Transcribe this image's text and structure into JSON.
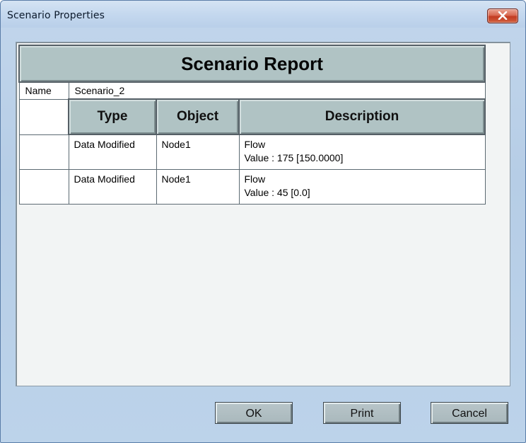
{
  "window": {
    "title": "Scenario Properties"
  },
  "report": {
    "title": "Scenario Report",
    "name_label": "Name",
    "name_value": "Scenario_2",
    "columns": [
      "Type",
      "Object",
      "Description"
    ],
    "rows": [
      {
        "type": "Data Modified",
        "object": "Node1",
        "description_line1": "Flow",
        "description_line2": "Value : 175 [150.0000]"
      },
      {
        "type": "Data Modified",
        "object": "Node1",
        "description_line1": "Flow",
        "description_line2": "Value : 45 [0.0]"
      }
    ]
  },
  "buttons": {
    "ok": "OK",
    "print": "Print",
    "cancel": "Cancel"
  },
  "icons": {
    "close": "close-icon"
  },
  "colors": {
    "close_button": "#c94a33",
    "header_fill": "#b0c3c4",
    "window_background": "#bcd3ea"
  }
}
